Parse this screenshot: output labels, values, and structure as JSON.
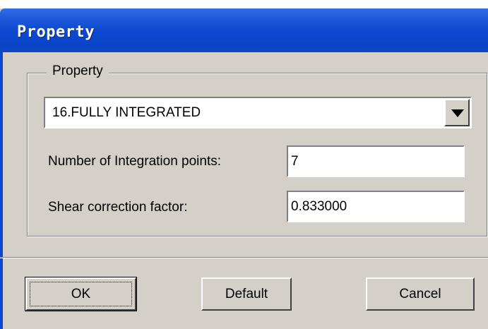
{
  "window": {
    "title": "Property"
  },
  "group": {
    "legend": "Property"
  },
  "property_select": {
    "value": "16.FULLY INTEGRATED"
  },
  "fields": {
    "integration_points": {
      "label": "Number of Integration points:",
      "value": "7"
    },
    "shear_correction": {
      "label": "Shear correction factor:",
      "value": "0.833000"
    }
  },
  "buttons": {
    "ok": "OK",
    "default": "Default",
    "cancel": "Cancel"
  },
  "colors": {
    "titlebar": "#0a44c6",
    "dialog_bg": "#d4d0c8"
  }
}
